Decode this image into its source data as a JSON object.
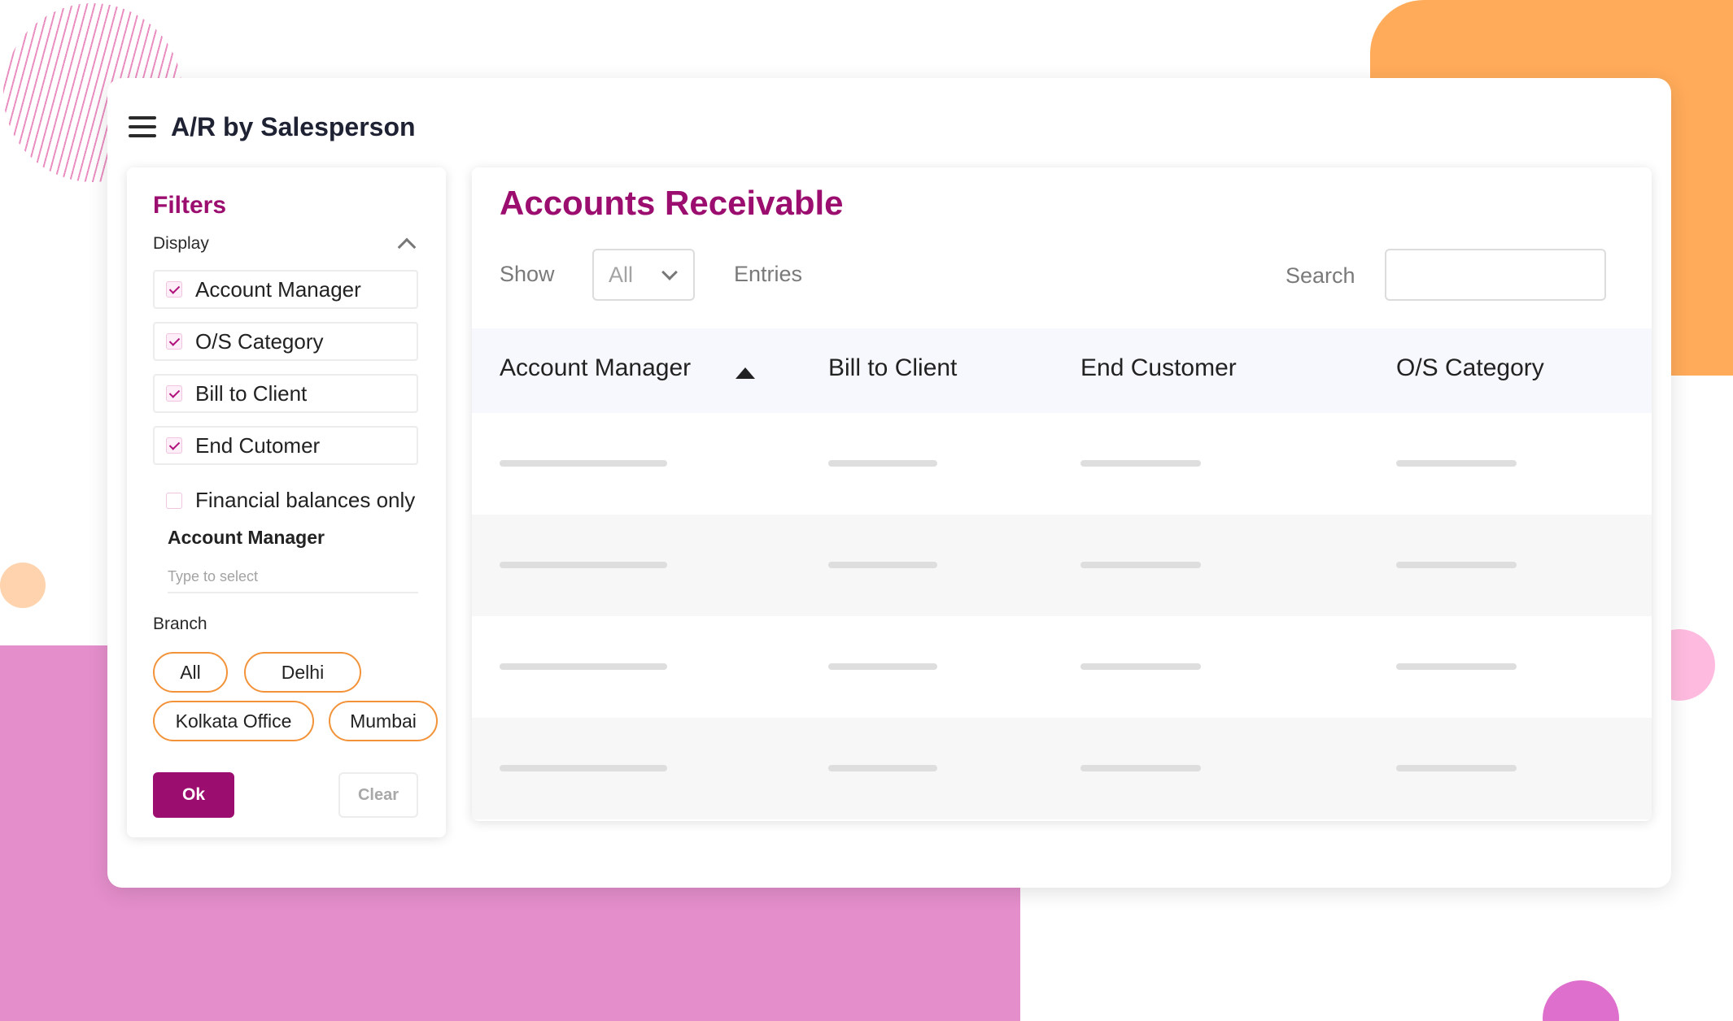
{
  "app": {
    "title": "A/R by Salesperson"
  },
  "filters": {
    "title": "Filters",
    "display_label": "Display",
    "display_options": [
      {
        "label": "Account Manager",
        "checked": true
      },
      {
        "label": "O/S Category",
        "checked": true
      },
      {
        "label": "Bill to Client",
        "checked": true
      },
      {
        "label": "End Cutomer",
        "checked": true
      },
      {
        "label": "Financial balances only",
        "checked": false
      }
    ],
    "account_manager": {
      "label": "Account Manager",
      "placeholder": "Type to select",
      "value": ""
    },
    "branch": {
      "label": "Branch",
      "options": [
        "All",
        "Delhi",
        "Kolkata Office",
        "Mumbai"
      ]
    },
    "ok_label": "Ok",
    "clear_label": "Clear"
  },
  "table": {
    "title": "Accounts Receivable",
    "show_label": "Show",
    "show_value": "All",
    "entries_label": "Entries",
    "search_label": "Search",
    "search_value": "",
    "columns": [
      "Account Manager",
      "Bill to Client",
      "End Customer",
      "O/S Category"
    ],
    "sorted_column": "Account Manager",
    "sort_direction": "ascending",
    "loading_rows": 4
  },
  "colors": {
    "brand": "#9b0d6e",
    "chip_border": "#f2933a",
    "deco_orange": "#ffab5a",
    "deco_pink": "#e48ecb"
  }
}
